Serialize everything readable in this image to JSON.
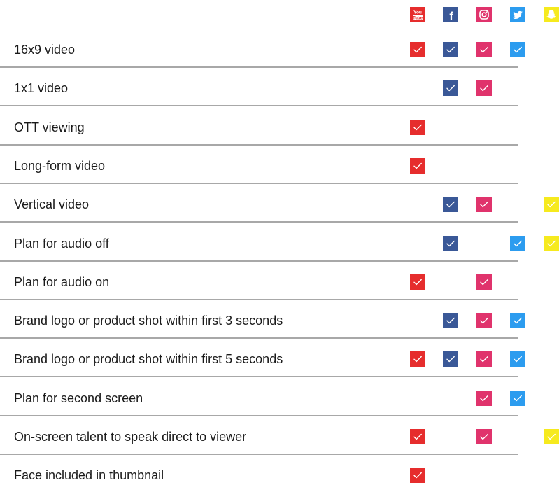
{
  "platforms": [
    {
      "id": "youtube",
      "label": "You Tube",
      "color": "#e62d2d",
      "icon": "youtube-icon"
    },
    {
      "id": "facebook",
      "label": "f",
      "color": "#3a5897",
      "icon": "facebook-icon"
    },
    {
      "id": "instagram",
      "label": "",
      "color": "#e0336c",
      "icon": "instagram-icon"
    },
    {
      "id": "twitter",
      "label": "",
      "color": "#2c9cef",
      "icon": "twitter-icon"
    },
    {
      "id": "snapchat",
      "label": "",
      "color": "#f6ea1e",
      "icon": "snapchat-icon"
    }
  ],
  "rows": [
    {
      "label": "16x9 video",
      "checks": [
        true,
        true,
        true,
        true,
        false
      ]
    },
    {
      "label": "1x1 video",
      "checks": [
        false,
        true,
        true,
        false,
        false
      ]
    },
    {
      "label": "OTT viewing",
      "checks": [
        true,
        false,
        false,
        false,
        false
      ]
    },
    {
      "label": "Long-form video",
      "checks": [
        true,
        false,
        false,
        false,
        false
      ]
    },
    {
      "label": "Vertical video",
      "checks": [
        false,
        true,
        true,
        false,
        true
      ]
    },
    {
      "label": "Plan for audio off",
      "checks": [
        false,
        true,
        false,
        true,
        true
      ]
    },
    {
      "label": "Plan for audio on",
      "checks": [
        true,
        false,
        true,
        false,
        false
      ]
    },
    {
      "label": "Brand logo or product shot within first 3 seconds",
      "checks": [
        false,
        true,
        true,
        true,
        false
      ]
    },
    {
      "label": "Brand logo or product shot within first 5 seconds",
      "checks": [
        true,
        true,
        true,
        true,
        false
      ]
    },
    {
      "label": "Plan for second screen",
      "checks": [
        false,
        false,
        true,
        true,
        false
      ]
    },
    {
      "label": "On-screen talent to speak direct to viewer",
      "checks": [
        true,
        false,
        true,
        false,
        true
      ]
    },
    {
      "label": "Face included in thumbnail",
      "checks": [
        true,
        false,
        false,
        false,
        false
      ]
    }
  ]
}
